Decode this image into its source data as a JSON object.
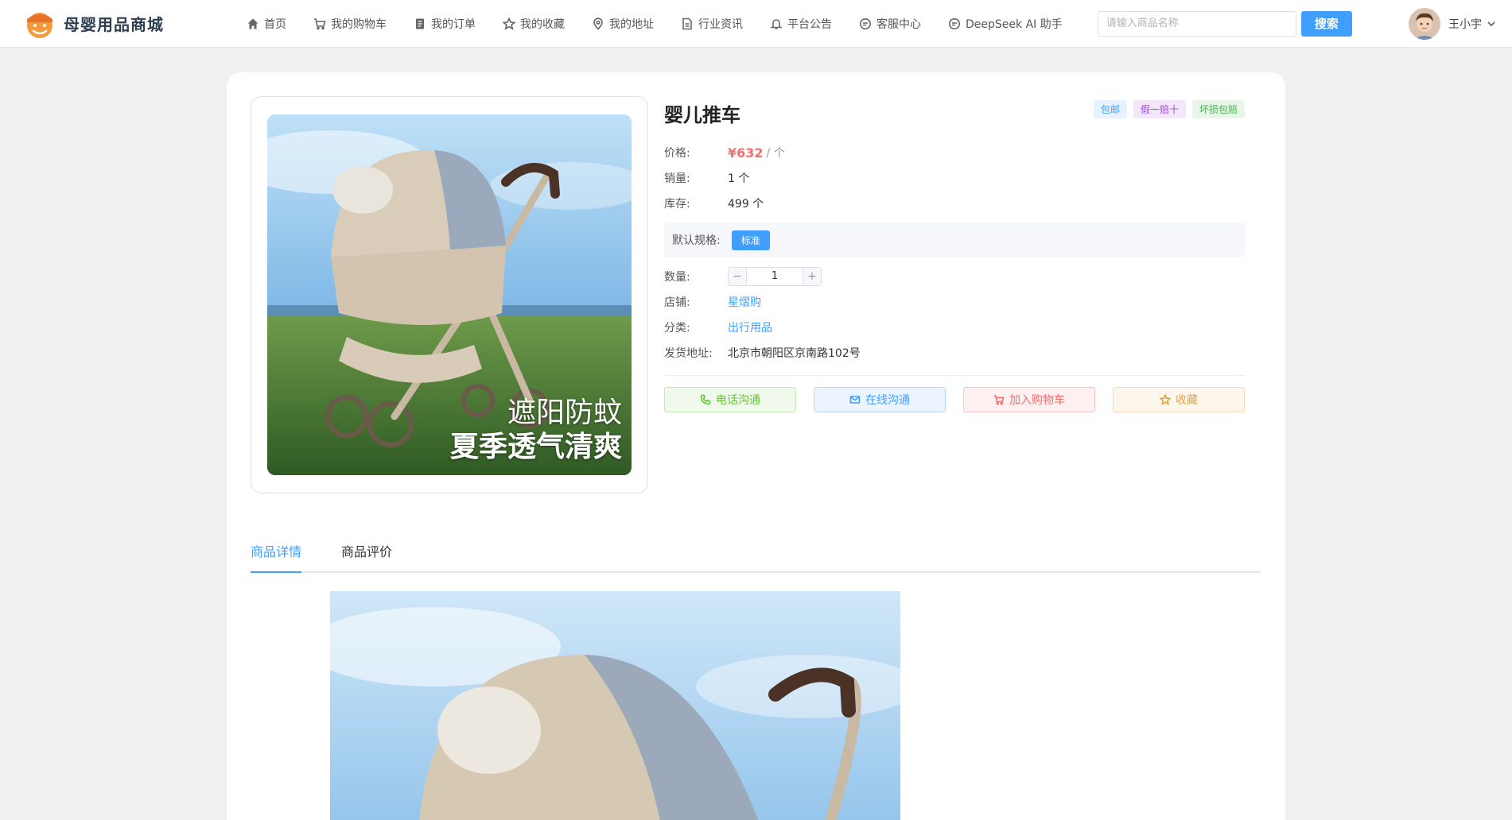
{
  "brand": {
    "name": "母婴用品商城"
  },
  "nav": [
    {
      "label": "首页",
      "icon": "home-icon"
    },
    {
      "label": "我的购物车",
      "icon": "cart-icon"
    },
    {
      "label": "我的订单",
      "icon": "order-icon"
    },
    {
      "label": "我的收藏",
      "icon": "star-icon"
    },
    {
      "label": "我的地址",
      "icon": "location-icon"
    },
    {
      "label": "行业资讯",
      "icon": "document-icon"
    },
    {
      "label": "平台公告",
      "icon": "bell-icon"
    },
    {
      "label": "客服中心",
      "icon": "chat-icon"
    },
    {
      "label": "DeepSeek AI 助手",
      "icon": "chat-icon"
    }
  ],
  "search": {
    "placeholder": "请输入商品名称",
    "button": "搜索"
  },
  "user": {
    "name": "王小宇"
  },
  "product": {
    "title": "婴儿推车",
    "badges": [
      {
        "label": "包邮",
        "color": "#409eff",
        "bg": "#e6f2ff"
      },
      {
        "label": "假一赔十",
        "color": "#9c4dcc",
        "bg": "#f3e8fb"
      },
      {
        "label": "坏损包赔",
        "color": "#4caf50",
        "bg": "#e8f5e9"
      }
    ],
    "price_label": "价格:",
    "price": "¥632",
    "price_unit": "/ 个",
    "sales_label": "销量:",
    "sales": "1 个",
    "stock_label": "库存:",
    "stock": "499 个",
    "spec_label": "默认规格:",
    "spec_value": "标准",
    "qty_label": "数量:",
    "qty": "1",
    "shop_label": "店铺:",
    "shop": "星熠购",
    "category_label": "分类:",
    "category": "出行用品",
    "address_label": "发货地址:",
    "address": "北京市朝阳区京南路102号",
    "image_caption_1": "遮阳防蚊",
    "image_caption_2": "夏季透气清爽"
  },
  "actions": [
    {
      "label": "电话沟通",
      "icon": "phone-icon",
      "color": "#67c23a",
      "bg": "#f0f9eb",
      "border": "#c2e7b0"
    },
    {
      "label": "在线沟通",
      "icon": "mail-icon",
      "color": "#409eff",
      "bg": "#ecf5ff",
      "border": "#b3d8ff"
    },
    {
      "label": "加入购物车",
      "icon": "cart-icon",
      "color": "#f56c6c",
      "bg": "#fef0f0",
      "border": "#fbc4c4"
    },
    {
      "label": "收藏",
      "icon": "star-icon",
      "color": "#e6a23c",
      "bg": "#fdf6ec",
      "border": "#f5dab1"
    }
  ],
  "tabs": [
    {
      "label": "商品详情",
      "active": true
    },
    {
      "label": "商品评价",
      "active": false
    }
  ]
}
